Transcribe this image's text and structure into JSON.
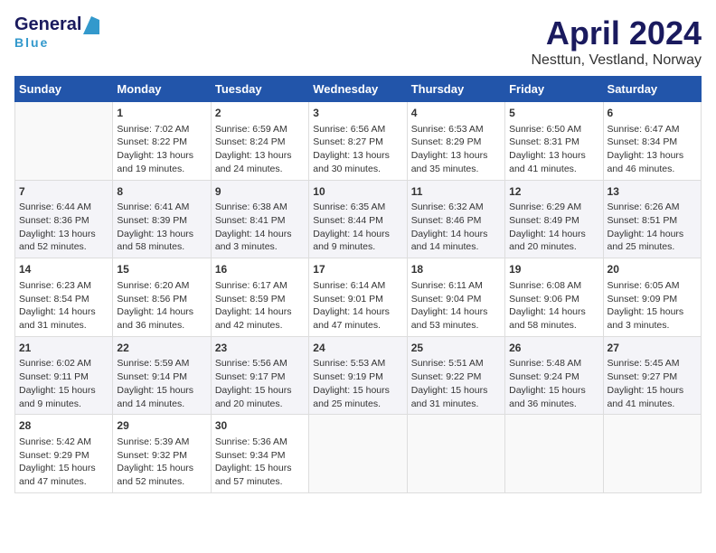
{
  "header": {
    "logo_general": "General",
    "logo_blue": "Blue",
    "month_title": "April 2024",
    "location": "Nesttun, Vestland, Norway"
  },
  "columns": [
    "Sunday",
    "Monday",
    "Tuesday",
    "Wednesday",
    "Thursday",
    "Friday",
    "Saturday"
  ],
  "weeks": [
    [
      {
        "day": "",
        "lines": []
      },
      {
        "day": "1",
        "lines": [
          "Sunrise: 7:02 AM",
          "Sunset: 8:22 PM",
          "Daylight: 13 hours",
          "and 19 minutes."
        ]
      },
      {
        "day": "2",
        "lines": [
          "Sunrise: 6:59 AM",
          "Sunset: 8:24 PM",
          "Daylight: 13 hours",
          "and 24 minutes."
        ]
      },
      {
        "day": "3",
        "lines": [
          "Sunrise: 6:56 AM",
          "Sunset: 8:27 PM",
          "Daylight: 13 hours",
          "and 30 minutes."
        ]
      },
      {
        "day": "4",
        "lines": [
          "Sunrise: 6:53 AM",
          "Sunset: 8:29 PM",
          "Daylight: 13 hours",
          "and 35 minutes."
        ]
      },
      {
        "day": "5",
        "lines": [
          "Sunrise: 6:50 AM",
          "Sunset: 8:31 PM",
          "Daylight: 13 hours",
          "and 41 minutes."
        ]
      },
      {
        "day": "6",
        "lines": [
          "Sunrise: 6:47 AM",
          "Sunset: 8:34 PM",
          "Daylight: 13 hours",
          "and 46 minutes."
        ]
      }
    ],
    [
      {
        "day": "7",
        "lines": [
          "Sunrise: 6:44 AM",
          "Sunset: 8:36 PM",
          "Daylight: 13 hours",
          "and 52 minutes."
        ]
      },
      {
        "day": "8",
        "lines": [
          "Sunrise: 6:41 AM",
          "Sunset: 8:39 PM",
          "Daylight: 13 hours",
          "and 58 minutes."
        ]
      },
      {
        "day": "9",
        "lines": [
          "Sunrise: 6:38 AM",
          "Sunset: 8:41 PM",
          "Daylight: 14 hours",
          "and 3 minutes."
        ]
      },
      {
        "day": "10",
        "lines": [
          "Sunrise: 6:35 AM",
          "Sunset: 8:44 PM",
          "Daylight: 14 hours",
          "and 9 minutes."
        ]
      },
      {
        "day": "11",
        "lines": [
          "Sunrise: 6:32 AM",
          "Sunset: 8:46 PM",
          "Daylight: 14 hours",
          "and 14 minutes."
        ]
      },
      {
        "day": "12",
        "lines": [
          "Sunrise: 6:29 AM",
          "Sunset: 8:49 PM",
          "Daylight: 14 hours",
          "and 20 minutes."
        ]
      },
      {
        "day": "13",
        "lines": [
          "Sunrise: 6:26 AM",
          "Sunset: 8:51 PM",
          "Daylight: 14 hours",
          "and 25 minutes."
        ]
      }
    ],
    [
      {
        "day": "14",
        "lines": [
          "Sunrise: 6:23 AM",
          "Sunset: 8:54 PM",
          "Daylight: 14 hours",
          "and 31 minutes."
        ]
      },
      {
        "day": "15",
        "lines": [
          "Sunrise: 6:20 AM",
          "Sunset: 8:56 PM",
          "Daylight: 14 hours",
          "and 36 minutes."
        ]
      },
      {
        "day": "16",
        "lines": [
          "Sunrise: 6:17 AM",
          "Sunset: 8:59 PM",
          "Daylight: 14 hours",
          "and 42 minutes."
        ]
      },
      {
        "day": "17",
        "lines": [
          "Sunrise: 6:14 AM",
          "Sunset: 9:01 PM",
          "Daylight: 14 hours",
          "and 47 minutes."
        ]
      },
      {
        "day": "18",
        "lines": [
          "Sunrise: 6:11 AM",
          "Sunset: 9:04 PM",
          "Daylight: 14 hours",
          "and 53 minutes."
        ]
      },
      {
        "day": "19",
        "lines": [
          "Sunrise: 6:08 AM",
          "Sunset: 9:06 PM",
          "Daylight: 14 hours",
          "and 58 minutes."
        ]
      },
      {
        "day": "20",
        "lines": [
          "Sunrise: 6:05 AM",
          "Sunset: 9:09 PM",
          "Daylight: 15 hours",
          "and 3 minutes."
        ]
      }
    ],
    [
      {
        "day": "21",
        "lines": [
          "Sunrise: 6:02 AM",
          "Sunset: 9:11 PM",
          "Daylight: 15 hours",
          "and 9 minutes."
        ]
      },
      {
        "day": "22",
        "lines": [
          "Sunrise: 5:59 AM",
          "Sunset: 9:14 PM",
          "Daylight: 15 hours",
          "and 14 minutes."
        ]
      },
      {
        "day": "23",
        "lines": [
          "Sunrise: 5:56 AM",
          "Sunset: 9:17 PM",
          "Daylight: 15 hours",
          "and 20 minutes."
        ]
      },
      {
        "day": "24",
        "lines": [
          "Sunrise: 5:53 AM",
          "Sunset: 9:19 PM",
          "Daylight: 15 hours",
          "and 25 minutes."
        ]
      },
      {
        "day": "25",
        "lines": [
          "Sunrise: 5:51 AM",
          "Sunset: 9:22 PM",
          "Daylight: 15 hours",
          "and 31 minutes."
        ]
      },
      {
        "day": "26",
        "lines": [
          "Sunrise: 5:48 AM",
          "Sunset: 9:24 PM",
          "Daylight: 15 hours",
          "and 36 minutes."
        ]
      },
      {
        "day": "27",
        "lines": [
          "Sunrise: 5:45 AM",
          "Sunset: 9:27 PM",
          "Daylight: 15 hours",
          "and 41 minutes."
        ]
      }
    ],
    [
      {
        "day": "28",
        "lines": [
          "Sunrise: 5:42 AM",
          "Sunset: 9:29 PM",
          "Daylight: 15 hours",
          "and 47 minutes."
        ]
      },
      {
        "day": "29",
        "lines": [
          "Sunrise: 5:39 AM",
          "Sunset: 9:32 PM",
          "Daylight: 15 hours",
          "and 52 minutes."
        ]
      },
      {
        "day": "30",
        "lines": [
          "Sunrise: 5:36 AM",
          "Sunset: 9:34 PM",
          "Daylight: 15 hours",
          "and 57 minutes."
        ]
      },
      {
        "day": "",
        "lines": []
      },
      {
        "day": "",
        "lines": []
      },
      {
        "day": "",
        "lines": []
      },
      {
        "day": "",
        "lines": []
      }
    ]
  ]
}
